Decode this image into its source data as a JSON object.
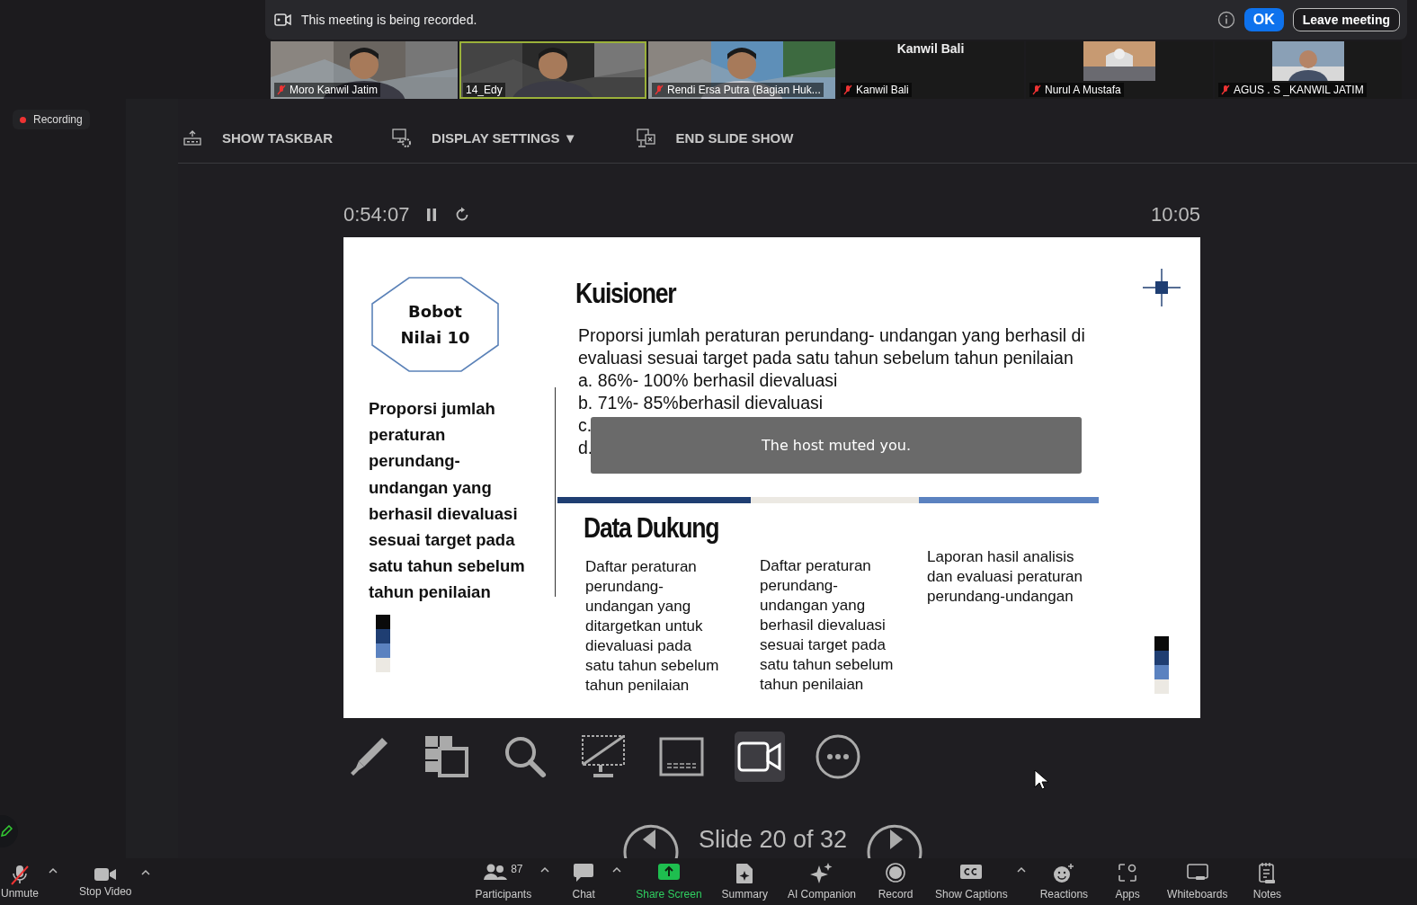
{
  "banner": {
    "message": "This meeting is being recorded.",
    "ok": "OK",
    "leave": "Leave meeting"
  },
  "participants": [
    {
      "name": "Moro Kanwil Jatim",
      "kind": "video",
      "muted": true,
      "speaking": false
    },
    {
      "name": "14_Edy",
      "kind": "video",
      "muted": false,
      "speaking": true
    },
    {
      "name": "Rendi Ersa Putra (Bagian Huk...",
      "kind": "video",
      "muted": true,
      "speaking": false
    },
    {
      "name": "Kanwil Bali",
      "kind": "name_only",
      "title": "Kanwil Bali",
      "muted": true,
      "speaking": false
    },
    {
      "name": "Nurul A Mustafa",
      "kind": "thumbnail",
      "muted": true,
      "speaking": false
    },
    {
      "name": "AGUS . S _KANWIL JATIM",
      "kind": "thumbnail",
      "muted": true,
      "speaking": false
    }
  ],
  "recording": "Recording",
  "slideshow_menu": [
    {
      "label": "SHOW TASKBAR",
      "kind": "taskbar"
    },
    {
      "label": "DISPLAY SETTINGS ▼",
      "kind": "display"
    },
    {
      "label": "END SLIDE SHOW",
      "kind": "end"
    }
  ],
  "timer": {
    "elapsed": "0:54:07",
    "clock": "10:05"
  },
  "slide": {
    "badge": [
      "Bobot",
      "Nilai 10"
    ],
    "indicator": "Proporsi jumlah peraturan perundang- undangan yang berhasil dievaluasi  sesuai target pada  satu tahun sebelum tahun penilaian",
    "title": "Kuisioner",
    "question": "Proporsi jumlah peraturan perundang-  undangan yang berhasil di evaluasi sesuai  target pada satu tahun sebelum tahun penilaian",
    "options": [
      "a. 86%- 100% berhasil dievaluasi",
      "b. 71%-  85%berhasil dievaluasi",
      "c.",
      "d."
    ],
    "support_title": "Data Dukung",
    "support": [
      "Daftar peraturan perundang- undangan  yang ditargetkan untuk dievaluasi pada satu tahun sebelum tahun penilaian",
      "Daftar peraturan perundang- undangan  yang berhasil  dievaluasi sesuai  target pada satu tahun sebelum tahun penilaian",
      "Laporan hasil analisis dan evaluasi peraturan perundang-undangan"
    ]
  },
  "toast": "The host muted you.",
  "slide_tools": [
    {
      "kind": "pen",
      "selected": false
    },
    {
      "kind": "thumbnails",
      "selected": false
    },
    {
      "kind": "zoom",
      "selected": false
    },
    {
      "kind": "screen",
      "selected": false
    },
    {
      "kind": "captions",
      "selected": false
    },
    {
      "kind": "camera",
      "selected": true
    },
    {
      "kind": "more",
      "selected": false
    }
  ],
  "slide_nav": "Slide 20 of 32",
  "toolbar_left": [
    {
      "label": "Unmute",
      "kind": "mic",
      "caret": true
    },
    {
      "label": "Stop Video",
      "kind": "video",
      "caret": true
    }
  ],
  "toolbar_center": [
    {
      "label": "Participants",
      "kind": "participants",
      "count": "87",
      "caret": true
    },
    {
      "label": "Chat",
      "kind": "chat",
      "caret": true
    },
    {
      "label": "Share Screen",
      "kind": "share",
      "caret": false
    },
    {
      "label": "Summary",
      "kind": "summary",
      "caret": false
    },
    {
      "label": "AI Companion",
      "kind": "ai",
      "caret": false
    },
    {
      "label": "Record",
      "kind": "record",
      "caret": false
    },
    {
      "label": "Show Captions",
      "kind": "captions",
      "caret": true
    },
    {
      "label": "Reactions",
      "kind": "reactions",
      "caret": false
    },
    {
      "label": "Apps",
      "kind": "apps",
      "caret": false
    },
    {
      "label": "Whiteboards",
      "kind": "whiteboards",
      "caret": false
    },
    {
      "label": "Notes",
      "kind": "notes",
      "caret": false
    }
  ]
}
